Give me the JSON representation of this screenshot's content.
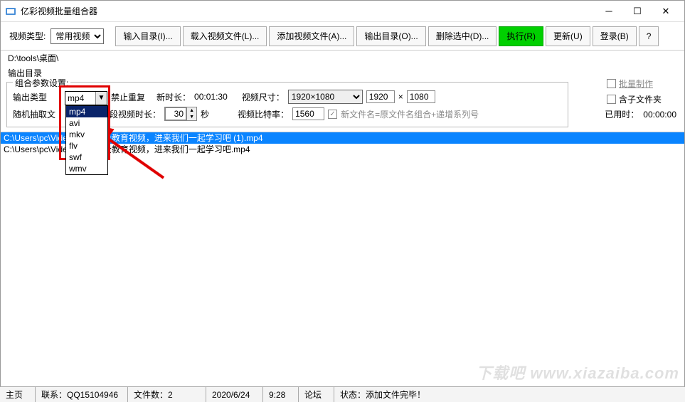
{
  "window": {
    "title": "亿彩视频批量组合器"
  },
  "toolbar": {
    "video_type_label": "视频类型:",
    "video_type_value": "常用视频",
    "input_dir": "输入目录(I)...",
    "load_files": "载入视频文件(L)...",
    "add_files": "添加视频文件(A)...",
    "output_dir": "输出目录(O)...",
    "delete_selected": "删除选中(D)...",
    "execute": "执行(R)",
    "update": "更新(U)",
    "login": "登录(B)",
    "help": "?"
  },
  "paths": {
    "input": "D:\\tools\\桌面\\",
    "output_label": "输出目录"
  },
  "settings": {
    "legend": "组合参数设置:",
    "output_type_label": "输出类型",
    "output_type_value": "mp4",
    "no_repeat": "禁止重复",
    "new_duration_label": "新时长：",
    "new_duration_value": "00:01:30",
    "video_size_label": "视频尺寸：",
    "video_size_value": "1920×1080",
    "width": "1920",
    "height": "1080",
    "size_x": "×",
    "random_extract": "随机抽取文",
    "segment_label": "每段视频时长：",
    "segment_value": "30",
    "seconds": "秒",
    "bitrate_label": "视频比特率：",
    "bitrate_value": "1560",
    "naming_label": "新文件名=原文件名组合+递增系列号"
  },
  "side": {
    "batch_make": "批量制作",
    "include_subfolder": "含子文件夹",
    "elapsed_label": "已用时：",
    "elapsed_value": "00:00:00"
  },
  "dropdown": {
    "options": [
      "mp4",
      "avi",
      "mkv",
      "flv",
      "swf",
      "wmv"
    ],
    "selected": "mp4"
  },
  "files": [
    {
      "path": "C:\\Users\\pc\\Vide",
      "tail": "全教育视频，进来我们一起学习吧 (1).mp4",
      "selected": true
    },
    {
      "path": "C:\\Users\\pc\\Vide",
      "tail": "全教育视频，进来我们一起学习吧.mp4",
      "selected": false
    }
  ],
  "statusbar": {
    "main": "主页",
    "contact": "联系：QQ15104946",
    "file_count": "文件数：2",
    "date": "2020/6/24",
    "time": "9:28",
    "forum": "论坛",
    "status": "状态：添加文件完毕！"
  },
  "watermark": "下载吧 www.xiazaiba.com"
}
